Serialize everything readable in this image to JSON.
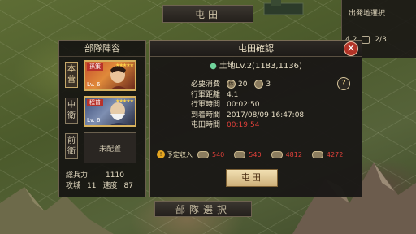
{
  "screen": {
    "top_banner": "屯田",
    "bottom_banner": "部隊選択"
  },
  "depart": {
    "title": "出発地選択",
    "value_a": "4.2",
    "value_b": "2/3"
  },
  "formation": {
    "title": "部隊陣容",
    "positions": [
      "本营",
      "中衛",
      "前衛"
    ],
    "cards": [
      {
        "name": "孫策",
        "level": "Lv. 6",
        "stars": "★★★★★"
      },
      {
        "name": "程普",
        "level": "Lv. 6",
        "stars": "★★★★★"
      }
    ],
    "empty_label": "未配置",
    "stats": {
      "troops_label": "総兵力",
      "troops_value": "1110",
      "siege_label": "攻城",
      "siege_value": "11",
      "speed_label": "速度",
      "speed_value": "87"
    }
  },
  "dialog": {
    "title": "屯田確認",
    "close": "×",
    "location": "土地Lv.2(1183,1136)",
    "help": "?",
    "rows": [
      {
        "key": "必要消費",
        "cost_a_icon": "体",
        "cost_a": "20",
        "cost_b": "3"
      },
      {
        "key": "行軍距離",
        "value": "4.1"
      },
      {
        "key": "行軍時間",
        "value": "00:02:50"
      },
      {
        "key": "到着時間",
        "value": "2017/08/09 16:47:08"
      },
      {
        "key": "屯田時間",
        "value": "00:19:54"
      }
    ],
    "expected_label": "予定収入",
    "resources": [
      {
        "icon": "wood-icon",
        "value": "540"
      },
      {
        "icon": "iron-icon",
        "value": "540"
      },
      {
        "icon": "stone-icon",
        "value": "4812"
      },
      {
        "icon": "grain-icon",
        "value": "4272"
      }
    ],
    "confirm_label": "屯田"
  },
  "colors": {
    "accent_gold": "#d7b15e",
    "red_value": "#e0403a",
    "close_red": "#b23327"
  }
}
